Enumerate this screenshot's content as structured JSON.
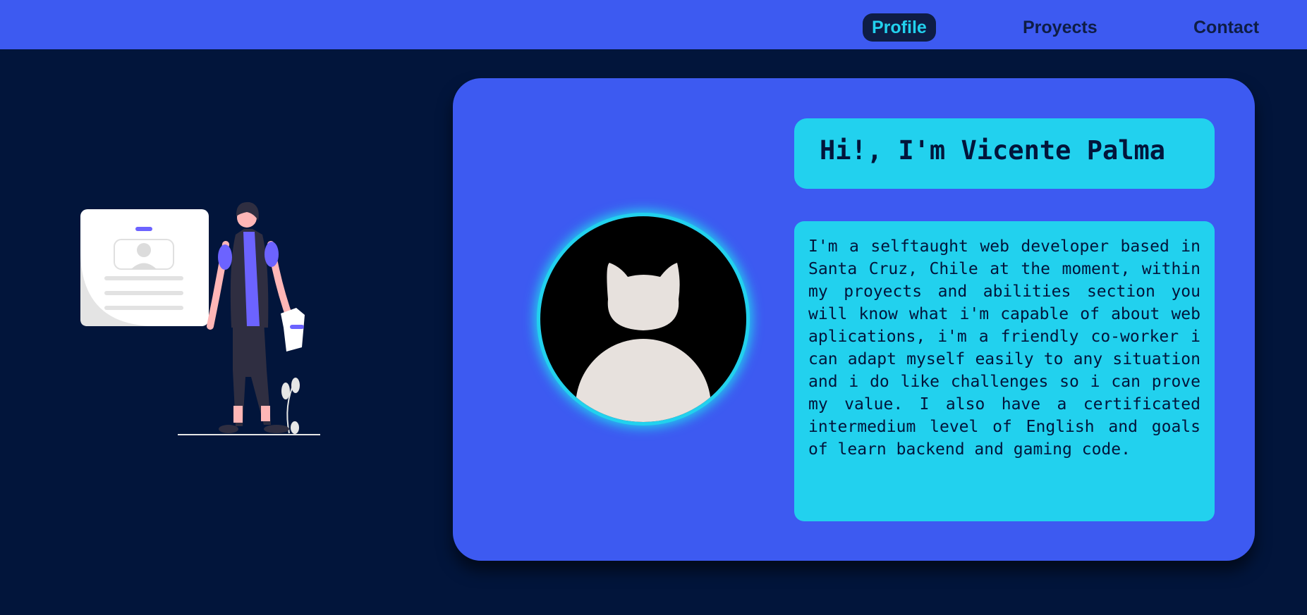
{
  "nav": {
    "items": [
      {
        "label": "Profile",
        "active": true
      },
      {
        "label": "Proyects",
        "active": false
      },
      {
        "label": "Contact",
        "active": false
      }
    ]
  },
  "profile": {
    "greeting": "Hi!, I'm Vicente Palma",
    "bio": "I'm a selftaught web developer based in Santa Cruz, Chile at the moment, within my proyects and abilities section you will know what i'm capable of about web aplications, i'm a friendly co-worker i can adapt myself easily to any situation and i do like challenges so i can prove my value. I also have a certificated intermedium level of English and goals of learn backend and gaming code.",
    "avatar_icon": "github-cat-avatar-icon"
  },
  "illustration": {
    "icon": "person-with-profile-card-icon"
  },
  "colors": {
    "background": "#02153b",
    "primary": "#3d5af1",
    "accent": "#22d1ee",
    "nav_text": "#0e1d45",
    "illustration_accent": "#6c63ff"
  }
}
